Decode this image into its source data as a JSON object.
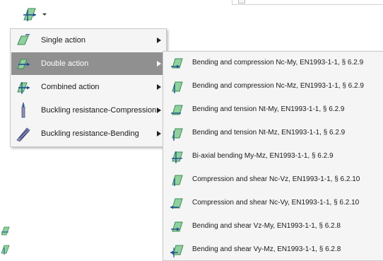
{
  "toolbar": {
    "main_icon": "beam-action-icon",
    "dropdown_icon": "dropdown-arrow-icon"
  },
  "menu": {
    "items": [
      {
        "label": "Single action",
        "icon": "single-action-icon",
        "has_submenu": true
      },
      {
        "label": "Double action",
        "icon": "double-action-icon",
        "has_submenu": true,
        "highlighted": true
      },
      {
        "label": "Combined action",
        "icon": "combined-action-icon",
        "has_submenu": true
      },
      {
        "label": "Buckling resistance-Compression",
        "icon": "buckling-compression-icon",
        "has_submenu": true
      },
      {
        "label": "Buckling resistance-Bending",
        "icon": "buckling-bending-icon",
        "has_submenu": true
      }
    ]
  },
  "submenu": {
    "items": [
      {
        "label": "Bending and compression Nc-My,  EN1993-1-1, § 6.2.9",
        "icon": "bending-compression-my-icon"
      },
      {
        "label": "Bending and compression Nc-Mz,  EN1993-1-1, § 6.2.9",
        "icon": "bending-compression-mz-icon"
      },
      {
        "label": "Bending and tension Nt-My,  EN1993-1-1, § 6.2.9",
        "icon": "bending-tension-my-icon"
      },
      {
        "label": "Bending and tension Nt-Mz,  EN1993-1-1, § 6.2.9",
        "icon": "bending-tension-mz-icon"
      },
      {
        "label": "Bi-axial bending My-Mz,  EN1993-1-1, § 6.2.9",
        "icon": "biaxial-bending-icon"
      },
      {
        "label": "Compression and shear Nc-Vz,  EN1993-1-1, § 6.2.10",
        "icon": "compression-shear-vz-icon"
      },
      {
        "label": "Compression and shear Nc-Vy,  EN1993-1-1, § 6.2.10",
        "icon": "compression-shear-vy-icon"
      },
      {
        "label": "Bending and shear Vz-My,  EN1993-1-1, § 6.2.8",
        "icon": "bending-shear-vz-icon"
      },
      {
        "label": "Bending and shear Vy-Mz,  EN1993-1-1, § 6.2.8",
        "icon": "bending-shear-vy-icon"
      }
    ]
  },
  "colors": {
    "beam_fill": "#8fd19e",
    "beam_stroke": "#3c8a55",
    "arrow": "#1d4f91",
    "highlight": "#909090"
  }
}
